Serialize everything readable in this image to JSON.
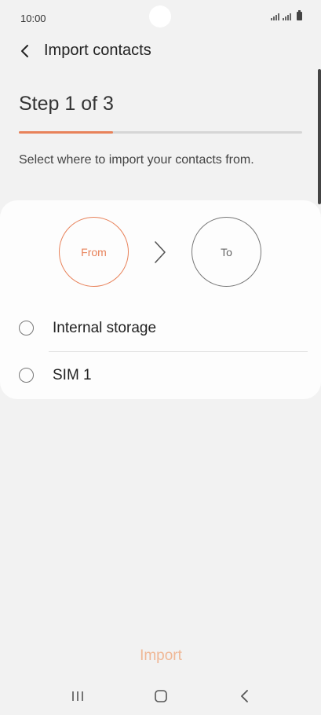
{
  "status_bar": {
    "time": "10:00"
  },
  "app_bar": {
    "back_icon": "chevron-left-icon",
    "title": "Import contacts"
  },
  "wizard": {
    "step_label": "Step 1 of 3",
    "progress": 0.333,
    "instruction": "Select where to import your contacts from."
  },
  "flow": {
    "from_label": "From",
    "to_label": "To",
    "arrow_icon": "chevron-right-icon"
  },
  "options": [
    {
      "label": "Internal storage",
      "selected": false
    },
    {
      "label": "SIM 1",
      "selected": false
    }
  ],
  "actions": {
    "import_label": "Import"
  },
  "colors": {
    "accent": "#e8825a",
    "accent_disabled": "#f0b896",
    "background": "#f2f2f2"
  }
}
